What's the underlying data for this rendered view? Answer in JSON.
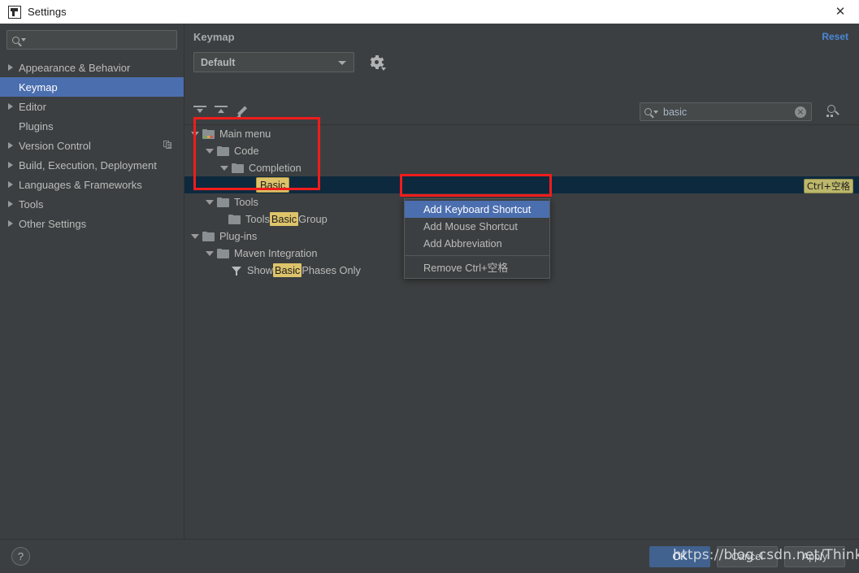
{
  "window": {
    "title": "Settings",
    "app_icon": "intellij-idea-icon",
    "close_label": "✕"
  },
  "sidebar": {
    "search": {
      "value": "",
      "placeholder": ""
    },
    "items": [
      {
        "label": "Appearance & Behavior",
        "expandable": true,
        "selected": false,
        "badge": false
      },
      {
        "label": "Keymap",
        "expandable": false,
        "selected": true,
        "badge": false
      },
      {
        "label": "Editor",
        "expandable": true,
        "selected": false,
        "badge": false
      },
      {
        "label": "Plugins",
        "expandable": false,
        "selected": false,
        "badge": false
      },
      {
        "label": "Version Control",
        "expandable": true,
        "selected": false,
        "badge": true
      },
      {
        "label": "Build, Execution, Deployment",
        "expandable": true,
        "selected": false,
        "badge": false
      },
      {
        "label": "Languages & Frameworks",
        "expandable": true,
        "selected": false,
        "badge": false
      },
      {
        "label": "Tools",
        "expandable": true,
        "selected": false,
        "badge": false
      },
      {
        "label": "Other Settings",
        "expandable": true,
        "selected": false,
        "badge": false
      }
    ]
  },
  "panel": {
    "title": "Keymap",
    "reset_label": "Reset",
    "keymap_select": {
      "value": "Default"
    },
    "gear_tooltip": "Show Scheme Actions"
  },
  "toolbar": {
    "expand_all": "expand-all",
    "collapse_all": "collapse-all",
    "edit": "edit-shortcut",
    "find_value": "basic",
    "clear_label": "×",
    "find_by_shortcut": "find-by-shortcut"
  },
  "tree": {
    "rows": [
      {
        "indent": 0,
        "arrow": "down",
        "icon": "main-menu-folder",
        "text_before": "Main menu",
        "highlight": "",
        "text_after": "",
        "selected": false,
        "shortcut": ""
      },
      {
        "indent": 1,
        "arrow": "down",
        "icon": "folder",
        "text_before": "Code",
        "highlight": "",
        "text_after": "",
        "selected": false,
        "shortcut": ""
      },
      {
        "indent": 2,
        "arrow": "down",
        "icon": "folder",
        "text_before": "Completion",
        "highlight": "",
        "text_after": "",
        "selected": false,
        "shortcut": ""
      },
      {
        "indent": 3,
        "arrow": "none",
        "icon": "none",
        "text_before": "",
        "highlight": "Basic",
        "text_after": "",
        "selected": true,
        "shortcut": "Ctrl+空格"
      },
      {
        "indent": 1,
        "arrow": "down",
        "icon": "folder",
        "text_before": "Tools",
        "highlight": "",
        "text_after": "",
        "selected": false,
        "shortcut": ""
      },
      {
        "indent": 2,
        "arrow": "none",
        "icon": "folder",
        "text_before": "Tools ",
        "highlight": "Basic",
        "text_after": " Group",
        "selected": false,
        "shortcut": ""
      },
      {
        "indent": 0,
        "arrow": "down",
        "icon": "folder",
        "text_before": "Plug-ins",
        "highlight": "",
        "text_after": "",
        "selected": false,
        "shortcut": ""
      },
      {
        "indent": 1,
        "arrow": "down",
        "icon": "folder",
        "text_before": "Maven Integration",
        "highlight": "",
        "text_after": "",
        "selected": false,
        "shortcut": ""
      },
      {
        "indent": 2,
        "arrow": "none",
        "icon": "funnel",
        "text_before": "Show ",
        "highlight": "Basic",
        "text_after": " Phases Only",
        "selected": false,
        "shortcut": ""
      }
    ]
  },
  "context_menu": {
    "items": [
      {
        "label": "Add Keyboard Shortcut",
        "highlighted": true,
        "separator_before": false
      },
      {
        "label": "Add Mouse Shortcut",
        "highlighted": false,
        "separator_before": false
      },
      {
        "label": "Add Abbreviation",
        "highlighted": false,
        "separator_before": false
      },
      {
        "label": "Remove Ctrl+空格",
        "highlighted": false,
        "separator_before": true
      }
    ]
  },
  "footer": {
    "help_label": "?",
    "ok_label": "OK",
    "cancel_label": "Cancel",
    "apply_label": "Apply"
  },
  "annotations": {
    "box_tree": "red-highlight-tree-path",
    "box_menu": "red-highlight-add-keyboard-shortcut"
  },
  "watermark": {
    "text": "https://blog.csdn.net/ThinkWon"
  },
  "colors": {
    "accent_selection": "#4b6eaf",
    "tree_selection": "#0d293e",
    "highlight_yellow": "#ddc36a",
    "link_blue": "#4a88d8",
    "annotation_red": "#f01c1c",
    "window_bg": "#3c3f41"
  }
}
